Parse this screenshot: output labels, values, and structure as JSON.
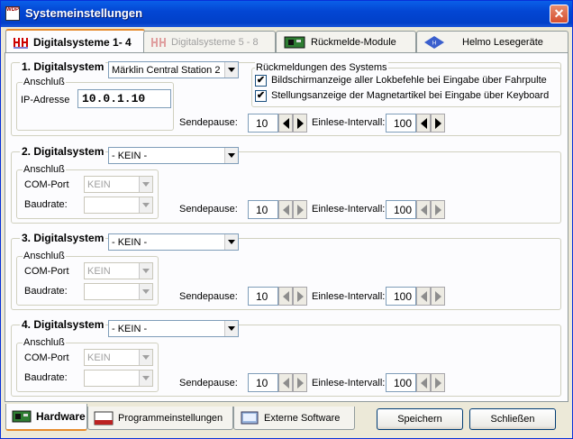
{
  "window": {
    "title": "Systemeinstellungen",
    "app_icon_text": "WDP",
    "close": "✕"
  },
  "tabs": [
    {
      "label": "Digitalsysteme 1- 4",
      "active": true
    },
    {
      "label": "Digitalsysteme 5 - 8",
      "disabled": true
    },
    {
      "label": "Rückmelde-Module"
    },
    {
      "label": "Helmo Lesegeräte"
    }
  ],
  "system1": {
    "title": "1. Digitalsystem",
    "type": "Märklin Central Station 2",
    "connection_title": "Anschluß",
    "ip_label": "IP-Adresse",
    "ip_value": "10.0.1.10",
    "feedback_title": "Rückmeldungen des Systems",
    "check1": "Bildschirmanzeige aller Lokbefehle bei Eingabe über Fahrpulte",
    "check2": "Stellungsanzeige der Magnetartikel bei Eingabe über Keyboard",
    "check_mark": "✔",
    "pause_label": "Sendepause:",
    "pause_value": "10",
    "interval_label": "Einlese-Intervall:",
    "interval_value": "100"
  },
  "system2": {
    "title": "2. Digitalsystem",
    "type": "- KEIN -",
    "connection_title": "Anschluß",
    "com_label": "COM-Port",
    "com_value": "KEIN",
    "baud_label": "Baudrate:",
    "baud_value": "",
    "pause_label": "Sendepause:",
    "pause_value": "10",
    "interval_label": "Einlese-Intervall:",
    "interval_value": "100"
  },
  "system3": {
    "title": "3. Digitalsystem",
    "type": "- KEIN -",
    "connection_title": "Anschluß",
    "com_label": "COM-Port",
    "com_value": "KEIN",
    "baud_label": "Baudrate:",
    "baud_value": "",
    "pause_label": "Sendepause:",
    "pause_value": "10",
    "interval_label": "Einlese-Intervall:",
    "interval_value": "100"
  },
  "system4": {
    "title": "4. Digitalsystem",
    "type": "- KEIN -",
    "connection_title": "Anschluß",
    "com_label": "COM-Port",
    "com_value": "KEIN",
    "baud_label": "Baudrate:",
    "baud_value": "",
    "pause_label": "Sendepause:",
    "pause_value": "10",
    "interval_label": "Einlese-Intervall:",
    "interval_value": "100"
  },
  "bottom_tabs": [
    {
      "label": "Hardware",
      "active": true
    },
    {
      "label": "Programmeinstellungen"
    },
    {
      "label": "Externe Software"
    }
  ],
  "buttons": {
    "save": "Speichern",
    "close": "Schließen"
  },
  "colors": {
    "title_bar": "#0A5FE8",
    "tab_highlight": "#E68B2C",
    "panel": "#FCFCFE",
    "window_bg": "#ECE9D8"
  }
}
